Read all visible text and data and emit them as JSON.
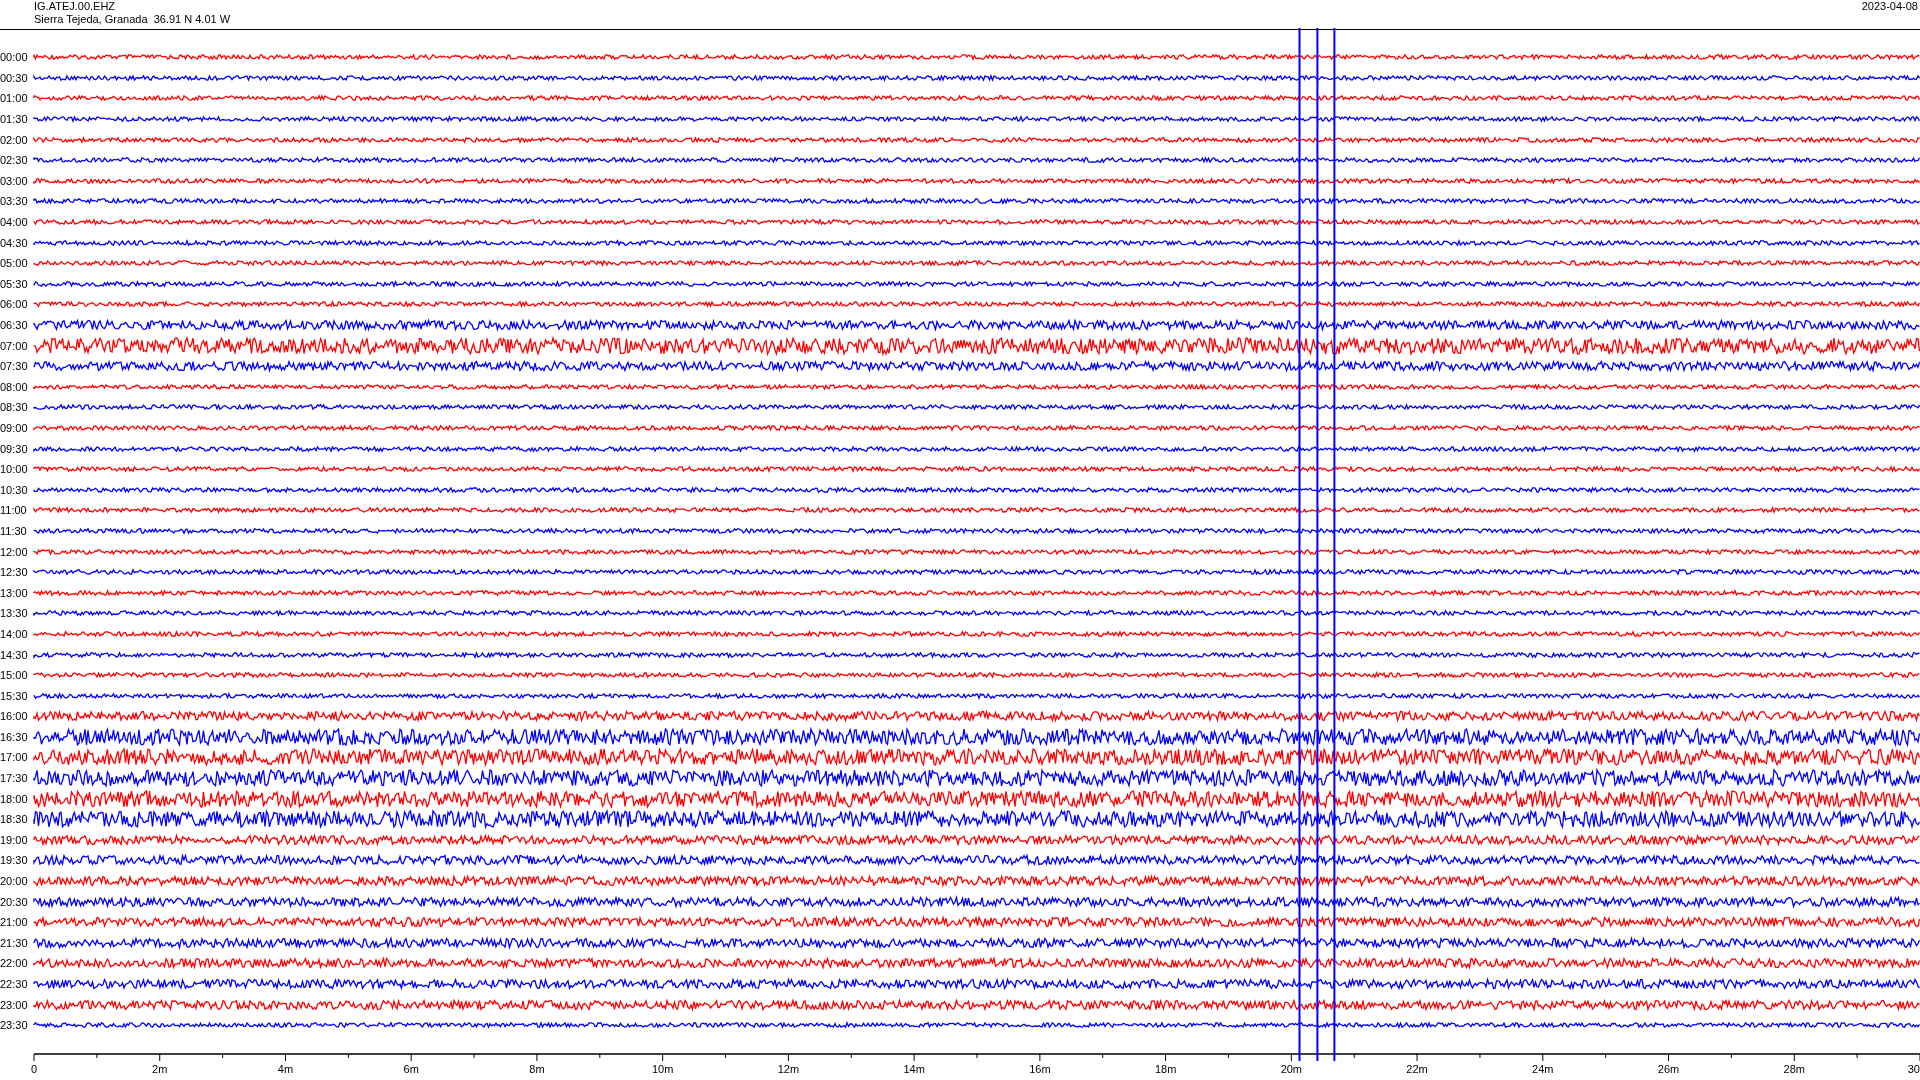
{
  "header": {
    "station": "IG.ATEJ.00.EHZ",
    "location": "Sierra Tejeda, Granada  36.91 N 4.01 W",
    "date": "2023-04-08"
  },
  "rows": [
    {
      "time": "00:00",
      "color": "#ff0000",
      "kind": "quiet"
    },
    {
      "time": "00:30",
      "color": "#0000ff",
      "kind": "quiet"
    },
    {
      "time": "01:00",
      "color": "#ff0000",
      "kind": "quiet"
    },
    {
      "time": "01:30",
      "color": "#0000ff",
      "kind": "quiet"
    },
    {
      "time": "02:00",
      "color": "#ff0000",
      "kind": "quiet"
    },
    {
      "time": "02:30",
      "color": "#0000ff",
      "kind": "quiet"
    },
    {
      "time": "03:00",
      "color": "#ff0000",
      "kind": "quiet"
    },
    {
      "time": "03:30",
      "color": "#0000ff",
      "kind": "quiet"
    },
    {
      "time": "04:00",
      "color": "#ff0000",
      "kind": "quiet"
    },
    {
      "time": "04:30",
      "color": "#0000ff",
      "kind": "quiet"
    },
    {
      "time": "05:00",
      "color": "#ff0000",
      "kind": "quiet"
    },
    {
      "time": "05:30",
      "color": "#0000ff",
      "kind": "quiet"
    },
    {
      "time": "06:00",
      "color": "#ff0000",
      "kind": "quiet"
    },
    {
      "time": "06:30",
      "color": "#0000ff",
      "kind": "medium"
    },
    {
      "time": "07:00",
      "color": "#ff0000",
      "kind": "noisy"
    },
    {
      "time": "07:30",
      "color": "#0000ff",
      "kind": "medium"
    },
    {
      "time": "08:00",
      "color": "#ff0000",
      "kind": "quiet"
    },
    {
      "time": "08:30",
      "color": "#0000ff",
      "kind": "quiet"
    },
    {
      "time": "09:00",
      "color": "#ff0000",
      "kind": "quiet"
    },
    {
      "time": "09:30",
      "color": "#0000ff",
      "kind": "quiet"
    },
    {
      "time": "10:00",
      "color": "#ff0000",
      "kind": "quiet"
    },
    {
      "time": "10:30",
      "color": "#0000ff",
      "kind": "quiet"
    },
    {
      "time": "11:00",
      "color": "#ff0000",
      "kind": "quiet"
    },
    {
      "time": "11:30",
      "color": "#0000ff",
      "kind": "quiet"
    },
    {
      "time": "12:00",
      "color": "#ff0000",
      "kind": "quiet"
    },
    {
      "time": "12:30",
      "color": "#0000ff",
      "kind": "quiet"
    },
    {
      "time": "13:00",
      "color": "#ff0000",
      "kind": "quiet"
    },
    {
      "time": "13:30",
      "color": "#0000ff",
      "kind": "quiet"
    },
    {
      "time": "14:00",
      "color": "#ff0000",
      "kind": "quiet"
    },
    {
      "time": "14:30",
      "color": "#0000ff",
      "kind": "quiet"
    },
    {
      "time": "15:00",
      "color": "#ff0000",
      "kind": "quiet"
    },
    {
      "time": "15:30",
      "color": "#0000ff",
      "kind": "quiet"
    },
    {
      "time": "16:00",
      "color": "#ff0000",
      "kind": "medium"
    },
    {
      "time": "16:30",
      "color": "#0000ff",
      "kind": "noisy"
    },
    {
      "time": "17:00",
      "color": "#ff0000",
      "kind": "noisy"
    },
    {
      "time": "17:30",
      "color": "#0000ff",
      "kind": "noisy"
    },
    {
      "time": "18:00",
      "color": "#ff0000",
      "kind": "noisy"
    },
    {
      "time": "18:30",
      "color": "#0000ff",
      "kind": "noisy"
    },
    {
      "time": "19:00",
      "color": "#ff0000",
      "kind": "medium"
    },
    {
      "time": "19:30",
      "color": "#0000ff",
      "kind": "medium"
    },
    {
      "time": "20:00",
      "color": "#ff0000",
      "kind": "medium"
    },
    {
      "time": "20:30",
      "color": "#0000ff",
      "kind": "medium"
    },
    {
      "time": "21:00",
      "color": "#ff0000",
      "kind": "medium"
    },
    {
      "time": "21:30",
      "color": "#0000ff",
      "kind": "medium"
    },
    {
      "time": "22:00",
      "color": "#ff0000",
      "kind": "medium"
    },
    {
      "time": "22:30",
      "color": "#0000ff",
      "kind": "medium"
    },
    {
      "time": "23:00",
      "color": "#ff0000",
      "kind": "medium"
    },
    {
      "time": "23:30",
      "color": "#0000ff",
      "kind": "quiet"
    }
  ],
  "x_axis": {
    "ticks": [
      "0",
      "2m",
      "4m",
      "6m",
      "8m",
      "10m",
      "12m",
      "14m",
      "16m",
      "18m",
      "20m",
      "22m",
      "24m",
      "26m",
      "28m",
      "30"
    ]
  }
}
